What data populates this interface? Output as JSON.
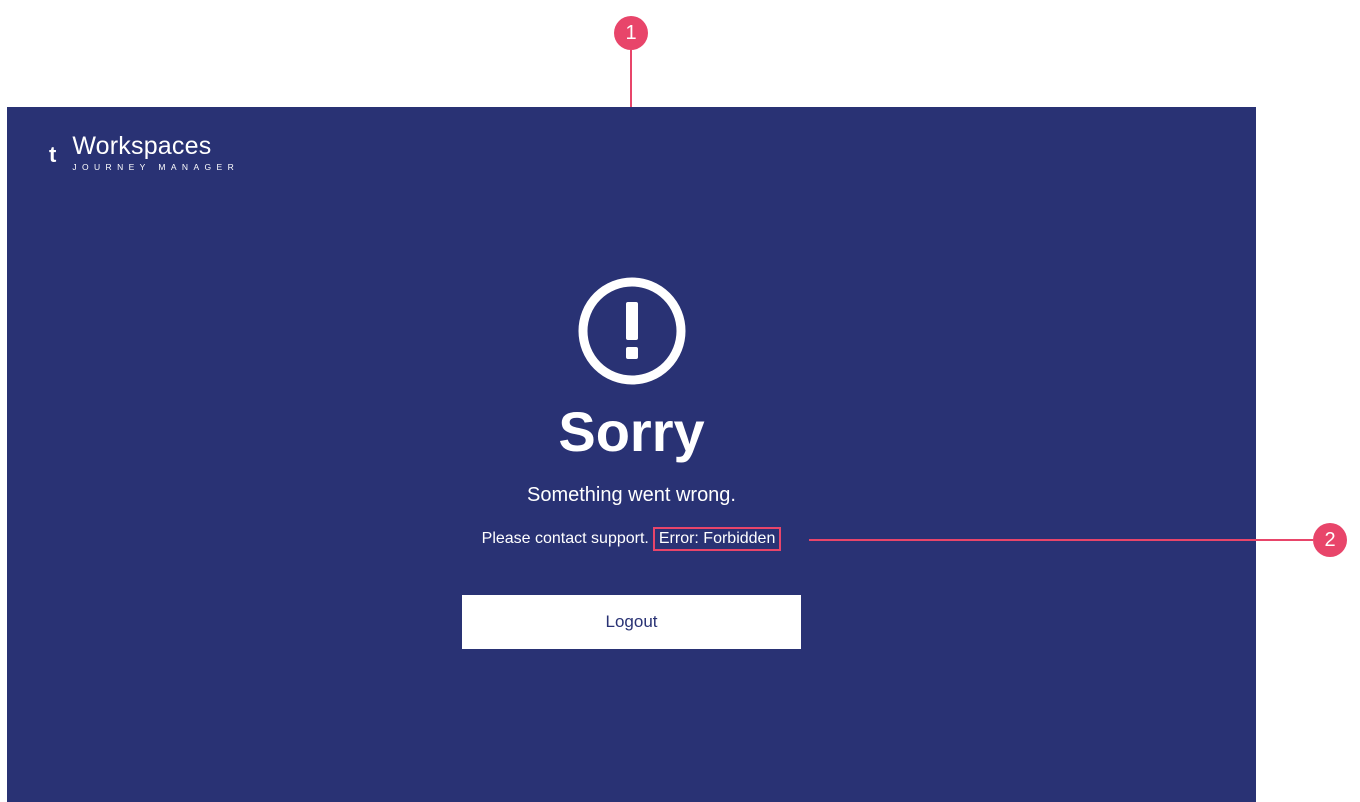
{
  "brand": {
    "mark": "t",
    "name": "Workspaces",
    "tagline": "JOURNEY MANAGER"
  },
  "error_page": {
    "icon": "exclamation-circle-icon",
    "title": "Sorry",
    "subtitle": "Something went wrong.",
    "support_text": "Please contact support.",
    "error_detail": "Error: Forbidden",
    "logout_label": "Logout"
  },
  "annotations": {
    "badge_1": "1",
    "badge_2": "2"
  },
  "colors": {
    "background": "#293274",
    "text": "#ffffff",
    "button_text": "#293274",
    "annotation": "#e8456a"
  }
}
